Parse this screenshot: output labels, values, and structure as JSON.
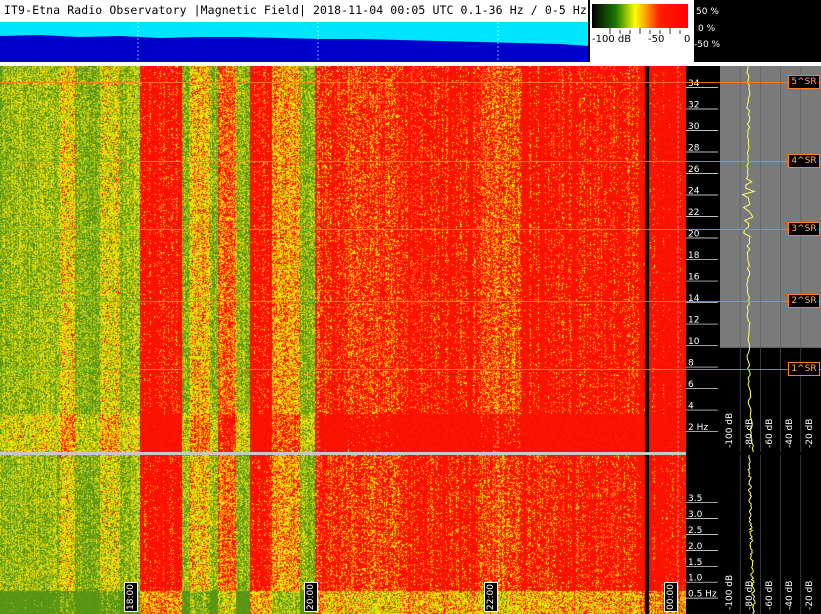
{
  "header": {
    "title": "IT9-Etna Radio Observatory |Magnetic Field| 2018-11-04 00:05 UTC 0.1-36 Hz / 0-5 Hz"
  },
  "legend": {
    "labels": [
      "-100 dB",
      "-50",
      "0"
    ],
    "percent_labels": [
      "50 %",
      "0 %",
      "-50 %"
    ]
  },
  "time_marks": [
    "18:00",
    "20:00",
    "22:00",
    "00:00"
  ],
  "sr_labels": [
    "5^SR",
    "4^SR",
    "3^SR",
    "2^SR",
    "1^SR"
  ],
  "colors": {
    "accent_orange": "#ff7f2a",
    "level_cyan": "#00e5ff",
    "level_blue": "#0000cc",
    "trace_yellow": "#ffff66"
  },
  "chart_data": [
    {
      "type": "heatmap",
      "name": "upper",
      "yaxis_unit": "Hz",
      "yticks": [
        2,
        4,
        6,
        8,
        10,
        12,
        14,
        16,
        18,
        20,
        22,
        24,
        26,
        28,
        30,
        32,
        34
      ],
      "ylim": [
        0.1,
        36
      ],
      "xticks": [
        "18:00",
        "20:00",
        "22:00",
        "00:00"
      ],
      "colorscale": [
        "#1a7a00",
        "#9acd32",
        "#ffff00",
        "#ffaa00",
        "#ff0000"
      ],
      "zlim_db": [
        -100,
        0
      ]
    },
    {
      "type": "heatmap",
      "name": "lower",
      "yaxis_unit": "Hz",
      "yticks": [
        0.5,
        1.0,
        1.5,
        2.0,
        2.5,
        3.0,
        3.5
      ],
      "ylim": [
        0,
        5
      ],
      "xticks": [
        "18:00",
        "20:00",
        "22:00",
        "00:00"
      ]
    },
    {
      "type": "line",
      "name": "average-spectrum-upper",
      "xlabels": [
        "-100 dB",
        "-80 dB",
        "-60 dB",
        "-40 dB",
        "-20 dB"
      ],
      "xlim": [
        -100,
        0
      ],
      "sr_freq_hz": [
        34.5,
        27.2,
        20.8,
        14.1,
        7.8
      ]
    },
    {
      "type": "line",
      "name": "average-spectrum-lower",
      "xlabels": [
        "-100 dB",
        "-80 dB",
        "-60 dB",
        "-40 dB",
        "-20 dB"
      ],
      "xlim": [
        -100,
        0
      ]
    }
  ]
}
